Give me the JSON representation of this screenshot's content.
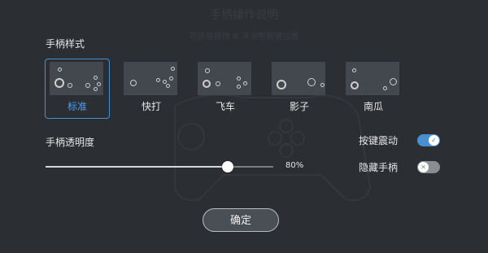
{
  "background_guide": {
    "title": "手柄操作说明",
    "subtitle": "可随意拖拽 ⊞ 来调整按键位置"
  },
  "styles_section": {
    "title": "手柄样式",
    "selected_index": 0,
    "items": [
      {
        "label": "标准"
      },
      {
        "label": "快打"
      },
      {
        "label": "飞车"
      },
      {
        "label": "影子"
      },
      {
        "label": "南瓜"
      }
    ]
  },
  "opacity_section": {
    "title": "手柄透明度",
    "value_label": "80%",
    "value_fraction": 0.8
  },
  "toggles": [
    {
      "label": "按键震动",
      "on": true,
      "icon": "check-icon"
    },
    {
      "label": "隐藏手柄",
      "on": false,
      "icon": "close-icon"
    }
  ],
  "confirm_button": {
    "label": "确定"
  },
  "colors": {
    "background": "#2b2e33",
    "accent": "#4a8fd0",
    "selected_label": "#4a9ff0"
  }
}
